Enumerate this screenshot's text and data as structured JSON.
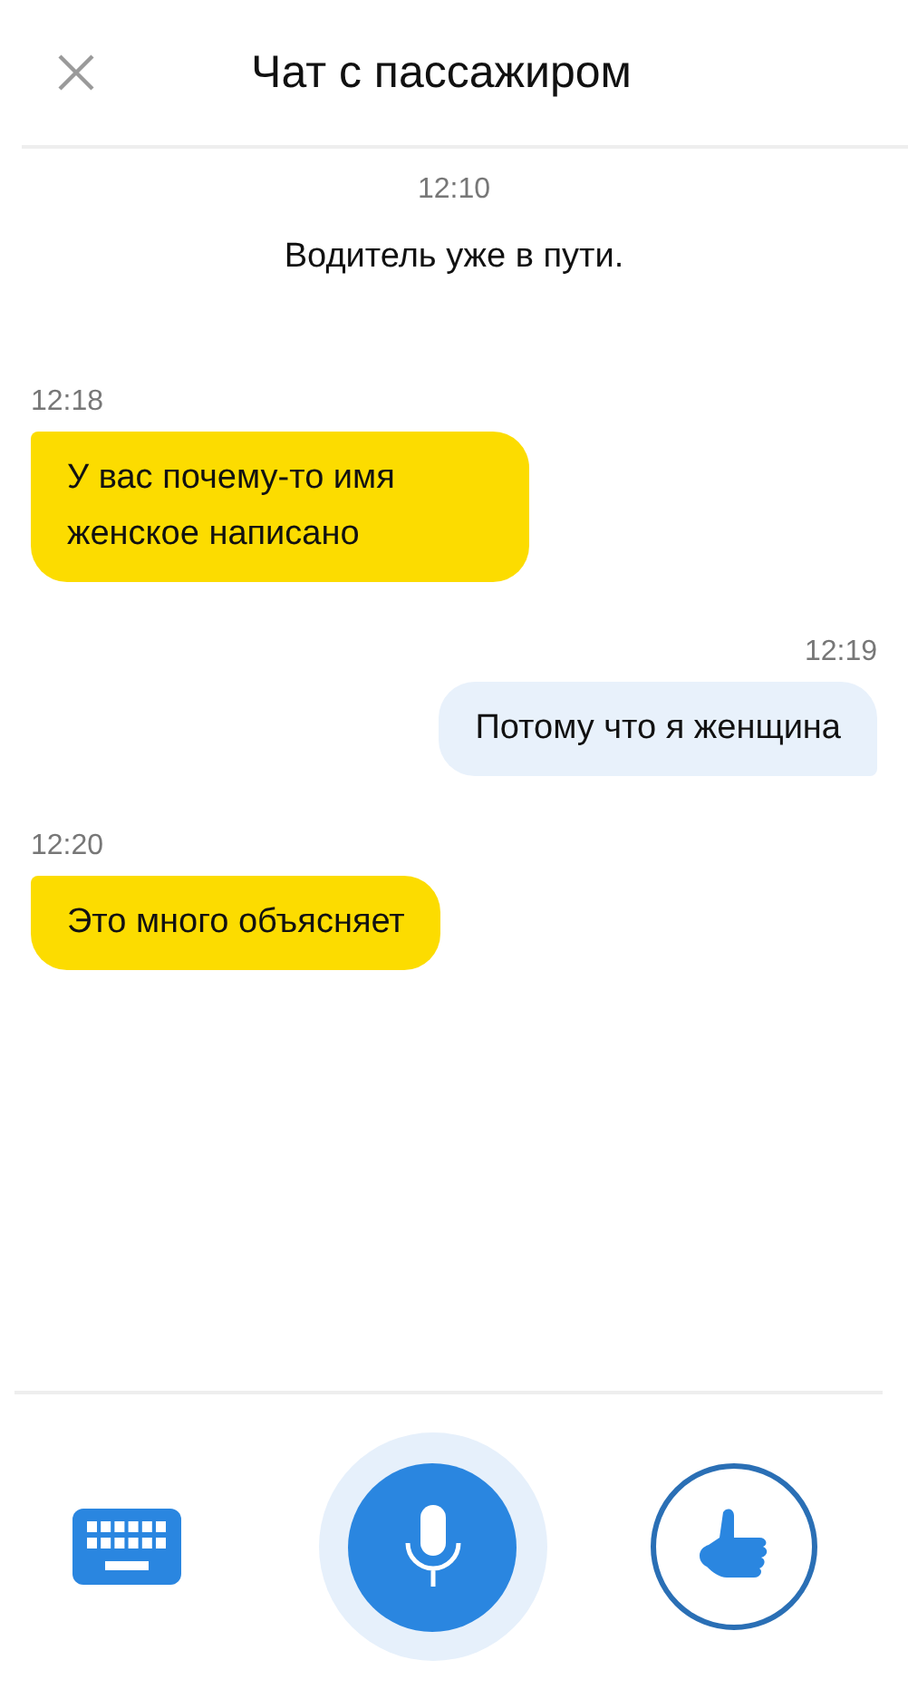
{
  "header": {
    "title": "Чат с пассажиром"
  },
  "messages": [
    {
      "kind": "system",
      "time": "12:10",
      "text": "Водитель уже в пути."
    },
    {
      "kind": "incoming",
      "time": "12:18",
      "text": "У вас почему-то имя женское написано"
    },
    {
      "kind": "outgoing",
      "time": "12:19",
      "text": "Потому что я женщина"
    },
    {
      "kind": "incoming",
      "time": "12:20",
      "text": "Это много объясняет"
    }
  ]
}
